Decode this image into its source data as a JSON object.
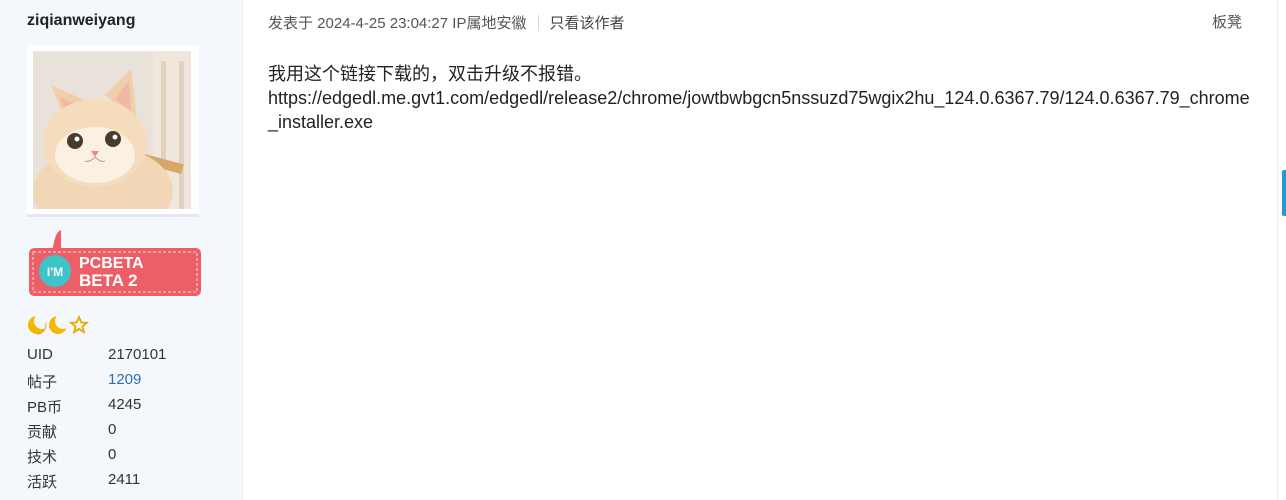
{
  "user": {
    "username": "ziqianweiyang",
    "badge": {
      "icon_text": "I'M",
      "line1": "PCBETA",
      "line2": "BETA 2"
    },
    "level_icons": [
      "moon-icon",
      "moon-icon",
      "star-icon"
    ],
    "stats": [
      {
        "label": "UID",
        "value": "2170101"
      },
      {
        "label": "帖子",
        "value": "1209"
      },
      {
        "label": "PB币",
        "value": "4245"
      },
      {
        "label": "贡献",
        "value": "0"
      },
      {
        "label": "技术",
        "value": "0"
      },
      {
        "label": "活跃",
        "value": "2411"
      }
    ]
  },
  "post": {
    "meta": "发表于 2024-4-25 23:04:27 IP属地安徽",
    "only_author": "只看该作者",
    "floor": "板凳",
    "content_line1": "我用这个链接下载的，双击升级不报错。",
    "content_line2": "https://edgedl.me.gvt1.com/edgedl/release2/chrome/jowtbwbgcn5nssuzd75wgix2hu_124.0.6367.79/124.0.6367.79_chrome_installer.exe"
  },
  "colors": {
    "badge_red": "#ec5f67",
    "badge_teal": "#3cc4c9",
    "link_blue": "#2b6cb0",
    "icon_yellow": "#f5b800",
    "scroll_blue": "#1e9ad6"
  }
}
